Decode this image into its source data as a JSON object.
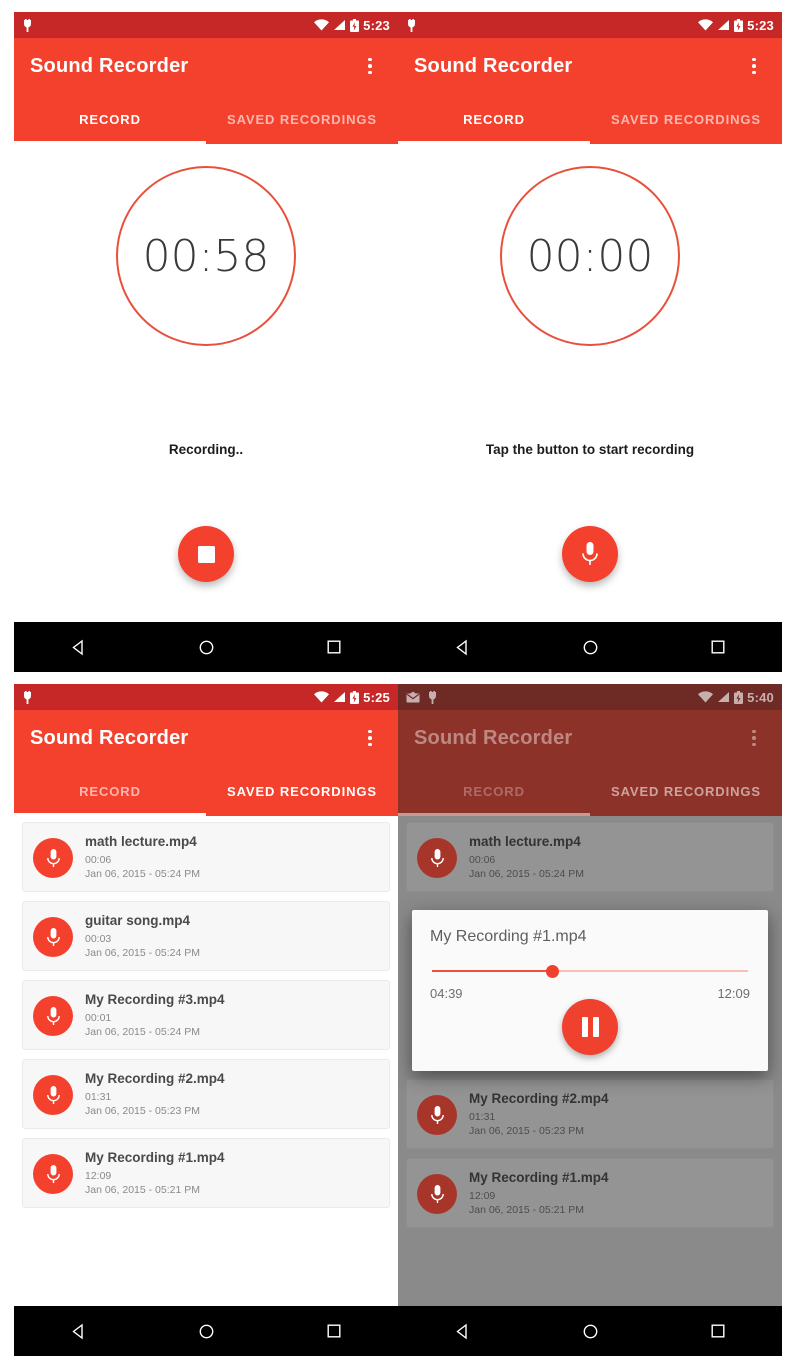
{
  "app": {
    "title": "Sound Recorder",
    "tabs": {
      "record": "RECORD",
      "saved": "SAVED RECORDINGS"
    }
  },
  "colors": {
    "primary": "#f4412d",
    "primary_dark": "#c62828",
    "accent": "#ef5138",
    "dim_primary": "#8d3229",
    "dim_primary_dark": "#6e2a25",
    "card_bg": "#f7f7f7",
    "nav_bg": "#000000"
  },
  "panels": {
    "top_left": {
      "status": {
        "time": "5:23"
      },
      "active_tab": "RECORD",
      "timer": "00:58",
      "hint": "Recording..",
      "fab_icon": "stop-icon"
    },
    "top_right": {
      "status": {
        "time": "5:23"
      },
      "active_tab": "RECORD",
      "timer": "00:00",
      "hint": "Tap the button to start recording",
      "fab_icon": "microphone-icon"
    },
    "bottom_left": {
      "status": {
        "time": "5:25"
      },
      "active_tab": "SAVED RECORDINGS",
      "recordings": [
        {
          "name": "math lecture.mp4",
          "duration": "00:06",
          "date": "Jan 06, 2015 - 05:24 PM"
        },
        {
          "name": "guitar song.mp4",
          "duration": "00:03",
          "date": "Jan 06, 2015 - 05:24 PM"
        },
        {
          "name": "My Recording #3.mp4",
          "duration": "00:01",
          "date": "Jan 06, 2015 - 05:24 PM"
        },
        {
          "name": "My Recording #2.mp4",
          "duration": "01:31",
          "date": "Jan 06, 2015 - 05:23 PM"
        },
        {
          "name": "My Recording #1.mp4",
          "duration": "12:09",
          "date": "Jan 06, 2015 - 05:21 PM"
        }
      ]
    },
    "bottom_right": {
      "status": {
        "time": "5:40"
      },
      "active_tab": "SAVED RECORDINGS",
      "recordings": [
        {
          "name": "math lecture.mp4",
          "duration": "00:06",
          "date": "Jan 06, 2015 - 05:24 PM"
        },
        {
          "name": "My Recording #2.mp4",
          "duration": "01:31",
          "date": "Jan 06, 2015 - 05:23 PM"
        },
        {
          "name": "My Recording #1.mp4",
          "duration": "12:09",
          "date": "Jan 06, 2015 - 05:21 PM"
        }
      ],
      "player": {
        "title": "My Recording #1.mp4",
        "current_time": "04:39",
        "total_time": "12:09",
        "progress_percent": 38,
        "fab_icon": "pause-icon"
      }
    }
  },
  "navbar": {
    "back": "back-triangle-icon",
    "home": "home-circle-icon",
    "recents": "recents-square-icon"
  }
}
